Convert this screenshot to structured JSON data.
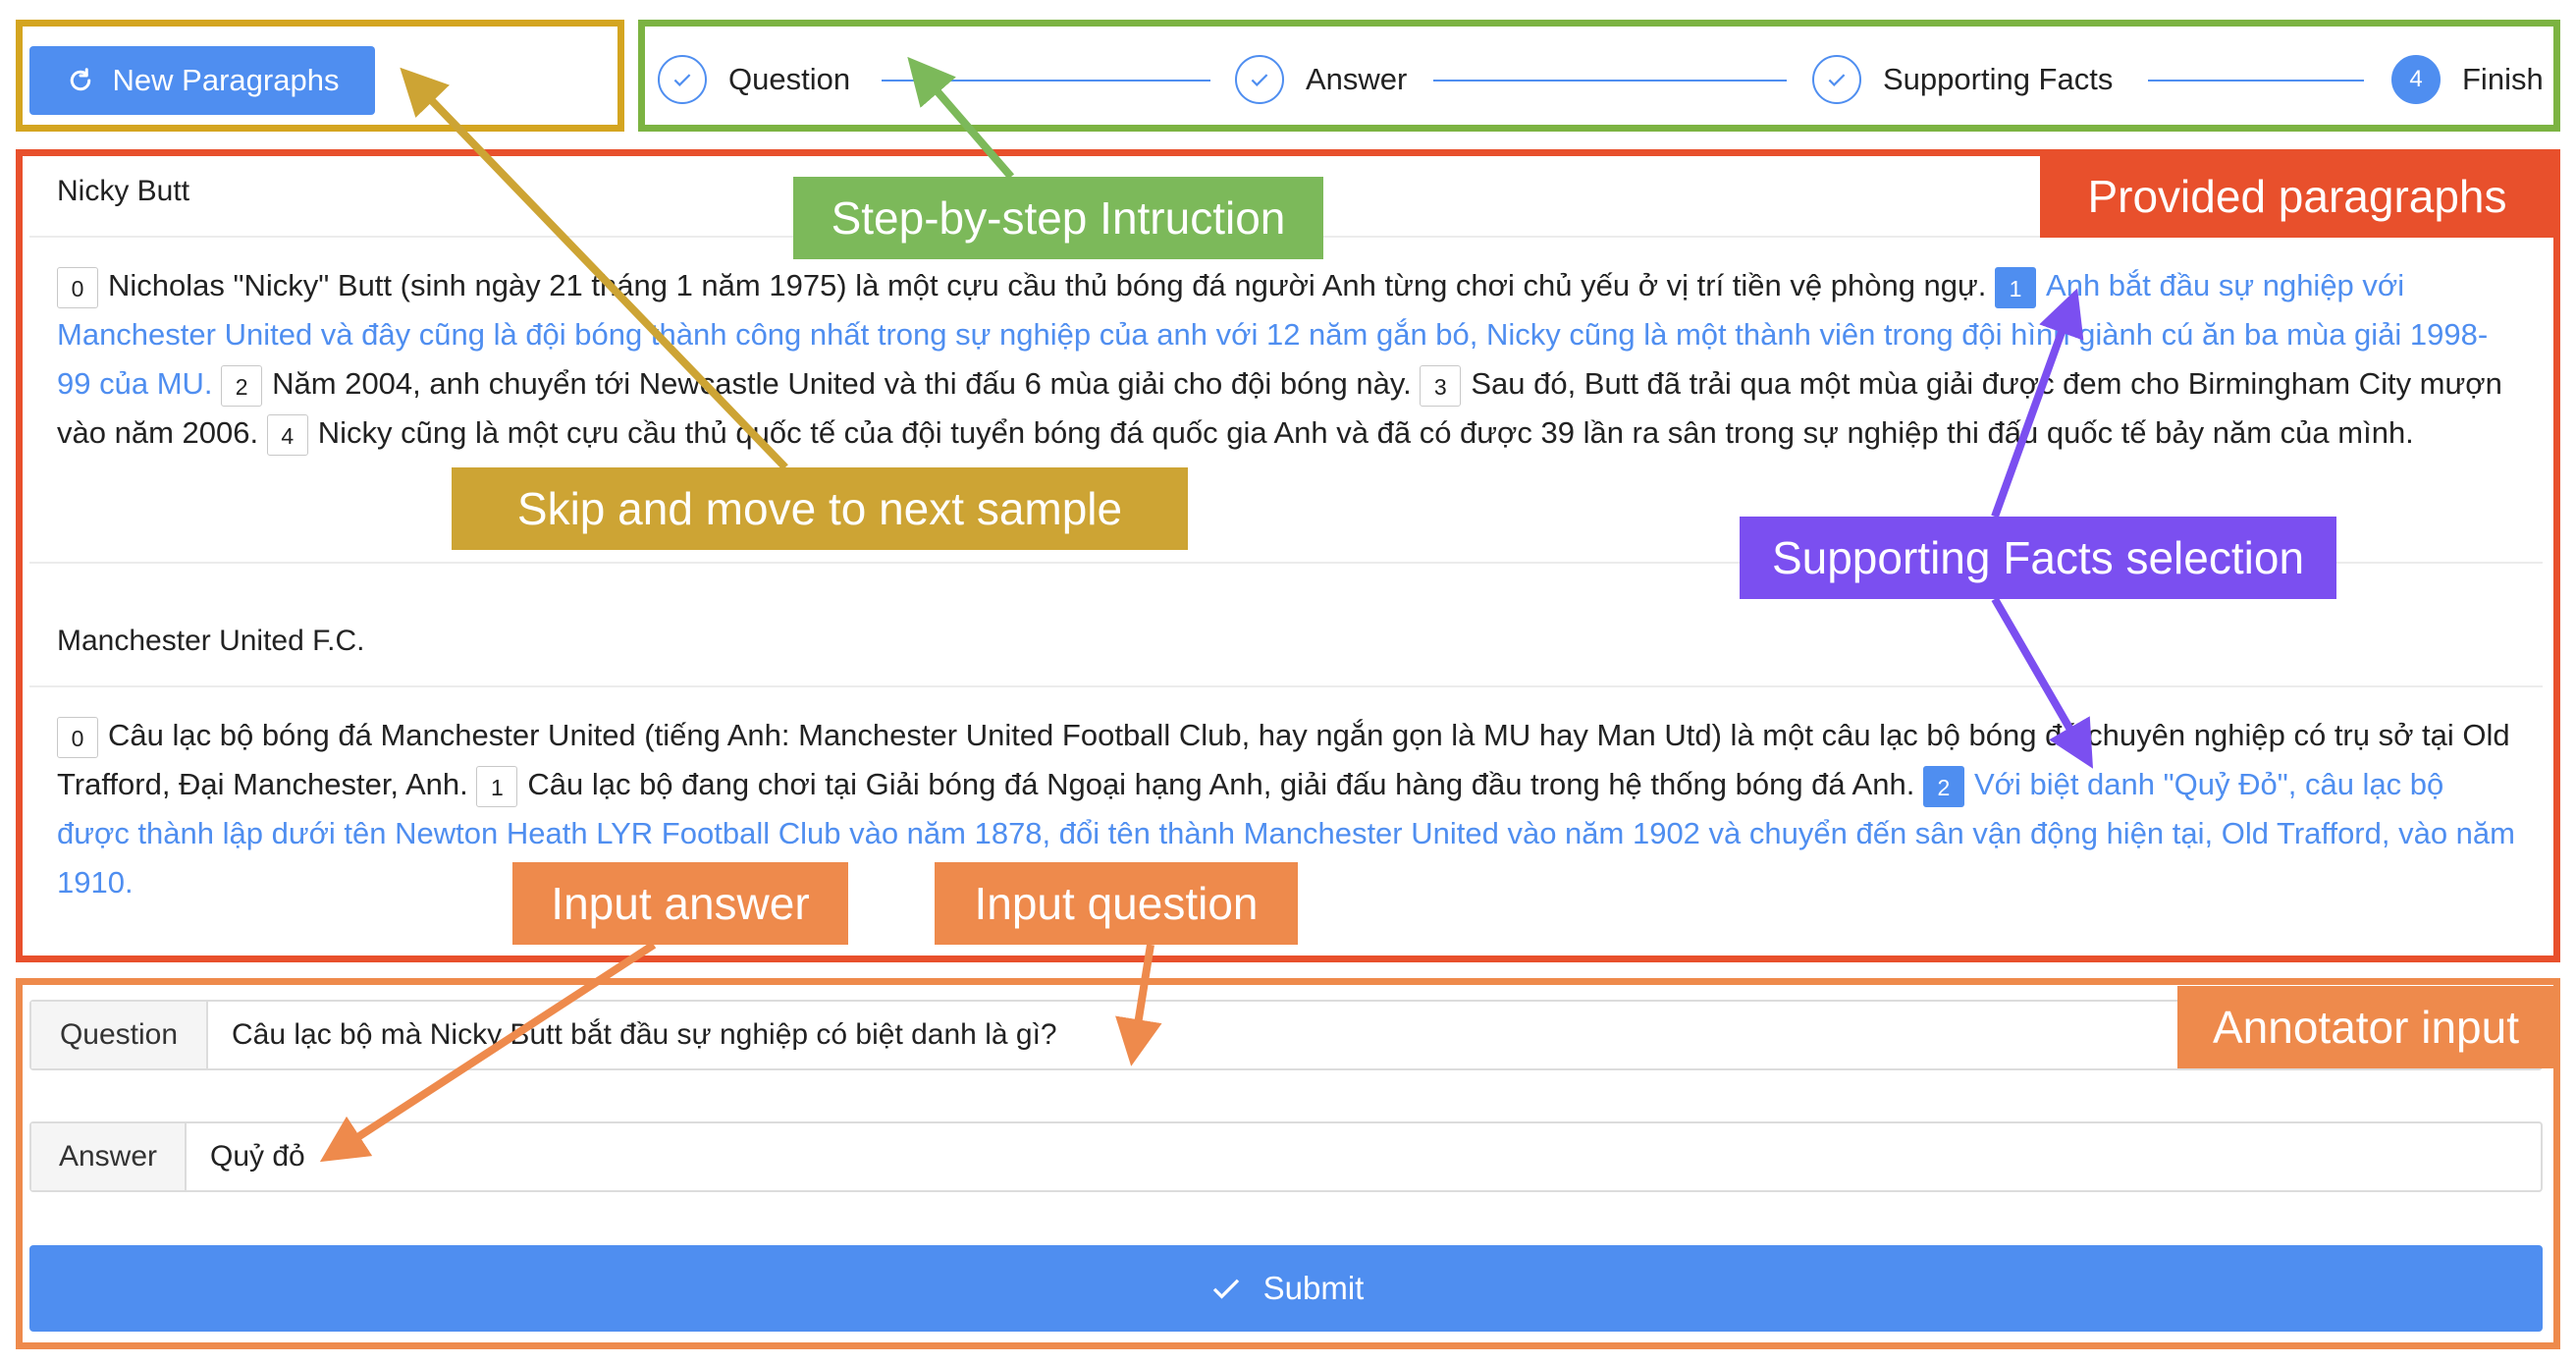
{
  "toolbar": {
    "new_paragraphs_label": "New Paragraphs",
    "refresh_icon": "refresh-icon"
  },
  "steps": [
    {
      "label": "Question",
      "state": "done"
    },
    {
      "label": "Answer",
      "state": "done"
    },
    {
      "label": "Supporting Facts",
      "state": "done"
    },
    {
      "label": "Finish",
      "number": "4",
      "state": "current"
    }
  ],
  "paragraphs": [
    {
      "title": "Nicky Butt",
      "sentences": [
        {
          "idx": "0",
          "text": "Nicholas \"Nicky\" Butt (sinh ngày 21 tháng 1 năm 1975) là một cựu cầu thủ bóng đá người Anh từng chơi chủ yếu ở vị trí tiền vệ phòng ngự.",
          "selected": false
        },
        {
          "idx": "1",
          "text": "Anh bắt đầu sự nghiệp với Manchester United và đây cũng là đội bóng thành công nhất trong sự nghiệp của anh với 12 năm gắn bó, Nicky cũng là một thành viên trong đội hình giành cú ăn ba mùa giải 1998-99 của MU.",
          "selected": true
        },
        {
          "idx": "2",
          "text": "Năm 2004, anh chuyển tới Newcastle United và thi đấu 6 mùa giải cho đội bóng này.",
          "selected": false
        },
        {
          "idx": "3",
          "text": "Sau đó, Butt đã trải qua một mùa giải được đem cho Birmingham City mượn vào năm 2006.",
          "selected": false
        },
        {
          "idx": "4",
          "text": "Nicky cũng là một cựu cầu thủ quốc tế của đội tuyển bóng đá quốc gia Anh và đã có được 39 lần ra sân trong sự nghiệp thi đấu quốc tế bảy năm của mình.",
          "selected": false
        }
      ]
    },
    {
      "title": "Manchester United F.C.",
      "sentences": [
        {
          "idx": "0",
          "text": "Câu lạc bộ bóng đá Manchester United (tiếng Anh: Manchester United Football Club, hay ngắn gọn là MU hay Man Utd) là một câu lạc bộ bóng đá chuyên nghiệp có trụ sở tại Old Trafford, Đại Manchester, Anh.",
          "selected": false
        },
        {
          "idx": "1",
          "text": "Câu lạc bộ đang chơi tại Giải bóng đá Ngoại hạng Anh, giải đấu hàng đầu trong hệ thống bóng đá Anh.",
          "selected": false
        },
        {
          "idx": "2",
          "text": "Với biệt danh \"Quỷ Đỏ\", câu lạc bộ được thành lập dưới tên Newton Heath LYR Football Club vào năm 1878, đổi tên thành Manchester United vào năm 1902 và chuyển đến sân vận động hiện tại, Old Trafford, vào năm 1910.",
          "selected": true
        }
      ]
    }
  ],
  "inputs": {
    "question_label": "Question",
    "question_value": "Câu lạc bộ mà Nicky Butt bắt đầu sự nghiệp có biệt danh là gì?",
    "answer_label": "Answer",
    "answer_value": "Quỷ đỏ",
    "submit_label": "Submit"
  },
  "annotations": {
    "step_by_step": "Step-by-step Intruction",
    "provided_paragraphs": "Provided paragraphs",
    "skip_next": "Skip and move to next sample",
    "supporting_facts": "Supporting Facts selection",
    "input_answer": "Input answer",
    "input_question": "Input question",
    "annotator_input": "Annotator input"
  },
  "colors": {
    "primary": "#4f8ef0",
    "frame_yellow": "#d4a520",
    "frame_green": "#7cb342",
    "frame_red": "#e8502c",
    "frame_orange": "#ee8a4c",
    "label_yellow": "#cda434",
    "label_green": "#7cb95a",
    "label_red": "#e8502c",
    "label_purple": "#7b4ff0",
    "label_orange": "#ee8a4c"
  }
}
